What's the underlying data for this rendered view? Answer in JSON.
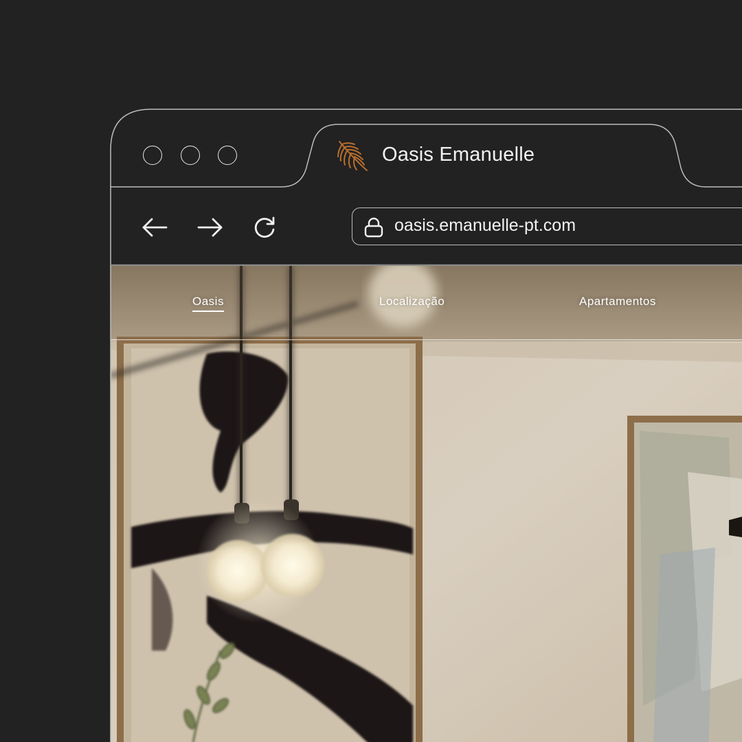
{
  "browser": {
    "tab": {
      "title": "Oasis Emanuelle",
      "favicon": "palm-leaf-icon",
      "favicon_color": "#b96f2c"
    },
    "toolbar": {
      "back_icon": "arrow-left-icon",
      "forward_icon": "arrow-right-icon",
      "reload_icon": "reload-icon",
      "secure_icon": "lock-icon",
      "url": "oasis.emanuelle-pt.com"
    }
  },
  "site": {
    "nav": [
      {
        "label": "Oasis",
        "active": true
      },
      {
        "label": "Localização",
        "active": false
      },
      {
        "label": "Apartamentos",
        "active": false
      }
    ]
  },
  "colors": {
    "background": "#222222",
    "outline": "#bdbdbd",
    "text": "#f2f2f2"
  }
}
